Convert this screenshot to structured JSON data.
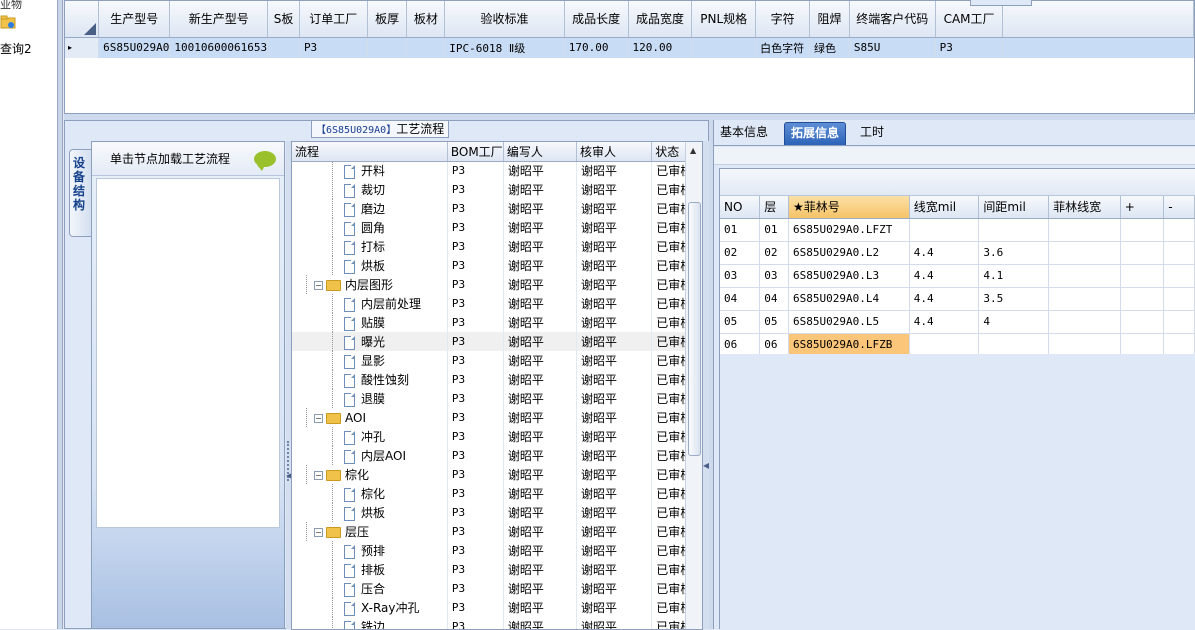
{
  "sidebar": {
    "cut_label": "业物",
    "item_label": "查询2"
  },
  "top_grid": {
    "columns": [
      "生产型号",
      "新生产型号",
      "S板",
      "订单工厂",
      "板厚",
      "板材",
      "验收标准",
      "成品长度",
      "成品宽度",
      "PNL规格",
      "字符",
      "阻焊",
      "终端客户代码",
      "CAM工厂"
    ],
    "row": [
      "6S85U029A0",
      "10010600061653",
      "",
      "P3",
      "",
      "",
      "IPC-6018 Ⅱ级",
      "170.00",
      "120.00",
      "",
      "白色字符",
      "绿色",
      "S85U",
      "P3"
    ],
    "row_indicator": "▸"
  },
  "process_panel": {
    "title_model": "【6S85U029A0】",
    "title_text": "工艺流程",
    "vertical_tab": "设备结构",
    "box_header": "单击节点加载工艺流程",
    "columns": [
      "流程",
      "BOM工厂",
      "编写人",
      "核审人",
      "状态"
    ],
    "rows": [
      {
        "name": "开料",
        "level": 2,
        "type": "doc",
        "bom": "P3",
        "writer": "谢昭平",
        "reviewer": "谢昭平",
        "status": "已审核"
      },
      {
        "name": "裁切",
        "level": 2,
        "type": "doc",
        "bom": "P3",
        "writer": "谢昭平",
        "reviewer": "谢昭平",
        "status": "已审核"
      },
      {
        "name": "磨边",
        "level": 2,
        "type": "doc",
        "bom": "P3",
        "writer": "谢昭平",
        "reviewer": "谢昭平",
        "status": "已审核"
      },
      {
        "name": "圆角",
        "level": 2,
        "type": "doc",
        "bom": "P3",
        "writer": "谢昭平",
        "reviewer": "谢昭平",
        "status": "已审核"
      },
      {
        "name": "打标",
        "level": 2,
        "type": "doc",
        "bom": "P3",
        "writer": "谢昭平",
        "reviewer": "谢昭平",
        "status": "已审核"
      },
      {
        "name": "烘板",
        "level": 2,
        "type": "doc",
        "bom": "P3",
        "writer": "谢昭平",
        "reviewer": "谢昭平",
        "status": "已审核"
      },
      {
        "name": "内层图形",
        "level": 1,
        "type": "folder",
        "bom": "P3",
        "writer": "谢昭平",
        "reviewer": "谢昭平",
        "status": "已审核"
      },
      {
        "name": "内层前处理",
        "level": 2,
        "type": "doc",
        "bom": "P3",
        "writer": "谢昭平",
        "reviewer": "谢昭平",
        "status": "已审核"
      },
      {
        "name": "贴膜",
        "level": 2,
        "type": "doc",
        "bom": "P3",
        "writer": "谢昭平",
        "reviewer": "谢昭平",
        "status": "已审核"
      },
      {
        "name": "曝光",
        "level": 2,
        "type": "doc",
        "bom": "P3",
        "writer": "谢昭平",
        "reviewer": "谢昭平",
        "status": "已审核",
        "selected": true
      },
      {
        "name": "显影",
        "level": 2,
        "type": "doc",
        "bom": "P3",
        "writer": "谢昭平",
        "reviewer": "谢昭平",
        "status": "已审核"
      },
      {
        "name": "酸性蚀刻",
        "level": 2,
        "type": "doc",
        "bom": "P3",
        "writer": "谢昭平",
        "reviewer": "谢昭平",
        "status": "已审核"
      },
      {
        "name": "退膜",
        "level": 2,
        "type": "doc",
        "bom": "P3",
        "writer": "谢昭平",
        "reviewer": "谢昭平",
        "status": "已审核"
      },
      {
        "name": "AOI",
        "level": 1,
        "type": "folder",
        "bom": "P3",
        "writer": "谢昭平",
        "reviewer": "谢昭平",
        "status": "已审核"
      },
      {
        "name": "冲孔",
        "level": 2,
        "type": "doc",
        "bom": "P3",
        "writer": "谢昭平",
        "reviewer": "谢昭平",
        "status": "已审核"
      },
      {
        "name": "内层AOI",
        "level": 2,
        "type": "doc",
        "bom": "P3",
        "writer": "谢昭平",
        "reviewer": "谢昭平",
        "status": "已审核"
      },
      {
        "name": "棕化",
        "level": 1,
        "type": "folder",
        "bom": "P3",
        "writer": "谢昭平",
        "reviewer": "谢昭平",
        "status": "已审核"
      },
      {
        "name": "棕化",
        "level": 2,
        "type": "doc",
        "bom": "P3",
        "writer": "谢昭平",
        "reviewer": "谢昭平",
        "status": "已审核"
      },
      {
        "name": "烘板",
        "level": 2,
        "type": "doc",
        "bom": "P3",
        "writer": "谢昭平",
        "reviewer": "谢昭平",
        "status": "已审核"
      },
      {
        "name": "层压",
        "level": 1,
        "type": "folder",
        "bom": "P3",
        "writer": "谢昭平",
        "reviewer": "谢昭平",
        "status": "已审核"
      },
      {
        "name": "预排",
        "level": 2,
        "type": "doc",
        "bom": "P3",
        "writer": "谢昭平",
        "reviewer": "谢昭平",
        "status": "已审核"
      },
      {
        "name": "排板",
        "level": 2,
        "type": "doc",
        "bom": "P3",
        "writer": "谢昭平",
        "reviewer": "谢昭平",
        "status": "已审核"
      },
      {
        "name": "压合",
        "level": 2,
        "type": "doc",
        "bom": "P3",
        "writer": "谢昭平",
        "reviewer": "谢昭平",
        "status": "已审核"
      },
      {
        "name": "X-Ray冲孔",
        "level": 2,
        "type": "doc",
        "bom": "P3",
        "writer": "谢昭平",
        "reviewer": "谢昭平",
        "status": "已审核"
      },
      {
        "name": "铣边",
        "level": 2,
        "type": "doc",
        "bom": "P3",
        "writer": "谢昭平",
        "reviewer": "谢昭平",
        "status": "已审核"
      }
    ]
  },
  "right_panel": {
    "tabs": [
      {
        "label": "基本信息",
        "active": false
      },
      {
        "label": "拓展信息",
        "active": true
      },
      {
        "label": "工时",
        "active": false
      }
    ],
    "columns": [
      "NO",
      "层",
      "★菲林号",
      "线宽mil",
      "间距mil",
      "菲林线宽",
      "+",
      "-"
    ],
    "rows": [
      [
        "01",
        "01",
        "6S85U029A0.LFZT",
        "",
        "",
        "",
        "",
        ""
      ],
      [
        "02",
        "02",
        "6S85U029A0.L2",
        "4.4",
        "3.6",
        "",
        "",
        ""
      ],
      [
        "03",
        "03",
        "6S85U029A0.L3",
        "4.4",
        "4.1",
        "",
        "",
        ""
      ],
      [
        "04",
        "04",
        "6S85U029A0.L4",
        "4.4",
        "3.5",
        "",
        "",
        ""
      ],
      [
        "05",
        "05",
        "6S85U029A0.L5",
        "4.4",
        "4",
        "",
        "",
        ""
      ],
      [
        "06",
        "06",
        "6S85U029A0.LFZB",
        "",
        "",
        "",
        "",
        ""
      ]
    ],
    "highlight_row": 5,
    "highlight_col": 2
  },
  "colors": {
    "accent": "#2c63b8",
    "selection": "#c9dcf5",
    "highlight": "#fbc57a",
    "folder": "#f0c24a"
  },
  "icons": {
    "folder": "folder-icon",
    "doc": "document-icon",
    "comment": "comment-bubble-icon"
  }
}
